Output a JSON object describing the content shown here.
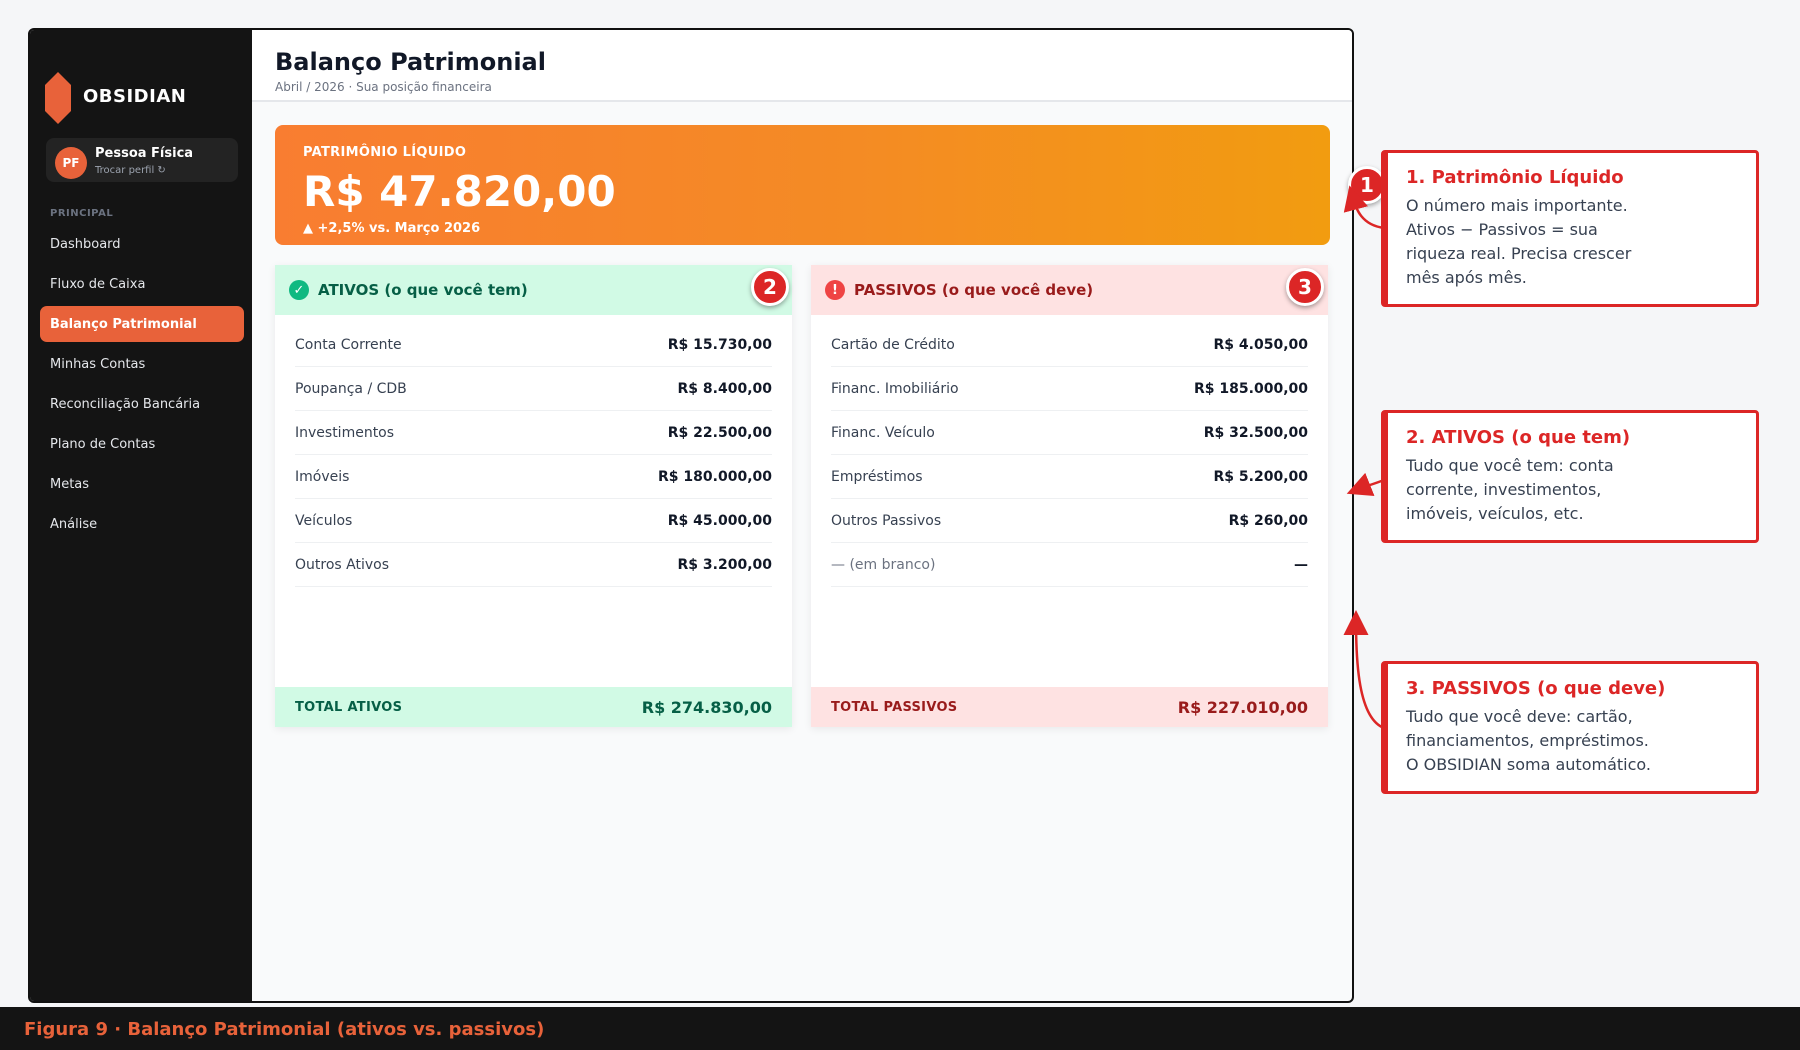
{
  "app": {
    "brand": "OBSIDIAN",
    "profile": {
      "initials": "PF",
      "name": "Pessoa Física",
      "switch_label": "Trocar perfil  ↻"
    },
    "nav_section": "PRINCIPAL",
    "nav_items": [
      {
        "label": "Dashboard"
      },
      {
        "label": "Fluxo de Caixa"
      },
      {
        "label": "Balanço Patrimonial",
        "active": true
      },
      {
        "label": "Minhas Contas"
      },
      {
        "label": "Reconciliação Bancária"
      },
      {
        "label": "Plano de Contas"
      },
      {
        "label": "Metas"
      },
      {
        "label": "Análise"
      }
    ]
  },
  "page": {
    "title": "Balanço Patrimonial",
    "subtitle": "Abril / 2026  ·  Sua posição financeira"
  },
  "net_worth": {
    "label": "PATRIMÔNIO LÍQUIDO",
    "value": "R$ 47.820,00",
    "change": "▲  +2,5% vs. Março 2026"
  },
  "assets": {
    "title": "ATIVOS (o que você tem)",
    "icon": "check-circle-icon",
    "rows": [
      {
        "label": "Conta Corrente",
        "value": "R$ 15.730,00"
      },
      {
        "label": "Poupança / CDB",
        "value": "R$ 8.400,00"
      },
      {
        "label": "Investimentos",
        "value": "R$ 22.500,00"
      },
      {
        "label": "Imóveis",
        "value": "R$ 180.000,00"
      },
      {
        "label": "Veículos",
        "value": "R$ 45.000,00"
      },
      {
        "label": "Outros Ativos",
        "value": "R$ 3.200,00"
      }
    ],
    "total_label": "TOTAL ATIVOS",
    "total_value": "R$ 274.830,00"
  },
  "liabilities": {
    "title": "PASSIVOS (o que você deve)",
    "icon": "alert-circle-icon",
    "rows": [
      {
        "label": "Cartão de Crédito",
        "value": "R$ 4.050,00"
      },
      {
        "label": "Financ. Imobiliário",
        "value": "R$ 185.000,00"
      },
      {
        "label": "Financ. Veículo",
        "value": "R$ 32.500,00"
      },
      {
        "label": "Empréstimos",
        "value": "R$ 5.200,00"
      },
      {
        "label": "Outros Passivos",
        "value": "R$ 260,00"
      },
      {
        "label": "— (em branco)",
        "value": "—"
      }
    ],
    "total_label": "TOTAL PASSIVOS",
    "total_value": "R$ 227.010,00"
  },
  "badges": [
    "1",
    "2",
    "3"
  ],
  "callouts": [
    {
      "title": "1. Patrimônio Líquido",
      "lines": [
        "O número mais importante.",
        "Ativos − Passivos = sua",
        "riqueza real. Precisa crescer",
        "mês após mês."
      ]
    },
    {
      "title": "2. ATIVOS (o que tem)",
      "lines": [
        "Tudo que você tem: conta",
        "corrente, investimentos,",
        "imóveis, veículos, etc."
      ]
    },
    {
      "title": "3. PASSIVOS (o que deve)",
      "lines": [
        "Tudo que você deve: cartão,",
        "financiamentos, empréstimos.",
        "O OBSIDIAN soma automático."
      ]
    }
  ],
  "colors": {
    "accent": "#e8623a",
    "annotation": "#dc2626",
    "asset": "#065f46",
    "liability": "#991b1b"
  },
  "caption": "Figura 9  ·  Balanço Patrimonial (ativos vs. passivos)"
}
